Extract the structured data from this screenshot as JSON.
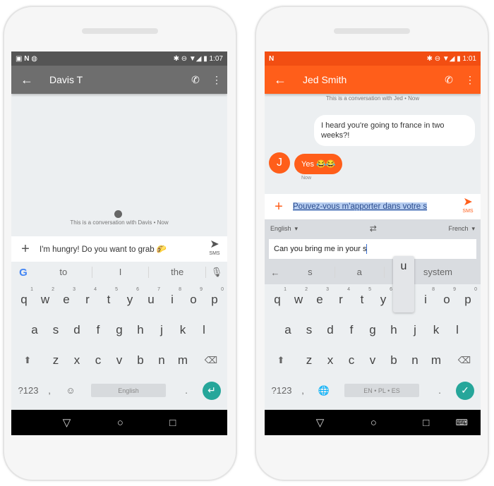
{
  "left_phone": {
    "status": {
      "left_icons": [
        "gallery-icon",
        "n-icon",
        "camera-icon"
      ],
      "time": "1:07",
      "right_icons": [
        "bluetooth-icon",
        "dnd-icon",
        "wifi-icon",
        "signal-icon",
        "battery-icon"
      ]
    },
    "toolbar": {
      "contact": "Davis T",
      "bg": "#6e6e6e",
      "status_bg": "#555555"
    },
    "conversation_note": "This is a conversation with Davis • Now",
    "compose": {
      "text": "I'm hungry! Do you want to grab 🌮",
      "send_label": "SMS"
    },
    "suggestions": [
      "to",
      "I",
      "the"
    ],
    "keyboard": {
      "rows": [
        [
          "q",
          "w",
          "e",
          "r",
          "t",
          "y",
          "u",
          "i",
          "o",
          "p"
        ],
        [
          "a",
          "s",
          "d",
          "f",
          "g",
          "h",
          "j",
          "k",
          "l"
        ],
        [
          "z",
          "x",
          "c",
          "v",
          "b",
          "n",
          "m"
        ]
      ],
      "numbers": [
        "1",
        "2",
        "3",
        "4",
        "5",
        "6",
        "7",
        "8",
        "9",
        "0"
      ],
      "symbols_label": "?123",
      "comma": ",",
      "period": ".",
      "space_label": "English",
      "action": "enter"
    }
  },
  "right_phone": {
    "status": {
      "left_icons": [
        "n-icon"
      ],
      "time": "1:01"
    },
    "toolbar": {
      "contact": "Jed Smith",
      "bg": "#ff5e1a",
      "status_bg": "#f24e12"
    },
    "conversation_note": "This is a conversation with Jed • Now",
    "messages": [
      {
        "from": "me",
        "text": "I heard you're going to france in two weeks?!"
      },
      {
        "from": "Jed",
        "avatar": "J",
        "text": "Yes 😂😂",
        "time": "Now"
      }
    ],
    "compose": {
      "text": "Pouvez-vous m'apporter dans votre s",
      "send_label": "SMS"
    },
    "translate": {
      "from": "English",
      "to": "French",
      "input": "Can you bring me in your s"
    },
    "suggestions": [
      "s",
      "a",
      "system"
    ],
    "key_popup": "u",
    "keyboard": {
      "symbols_label": "?123",
      "comma": ",",
      "period": ".",
      "space_label": "EN • PL • ES",
      "action": "done"
    }
  },
  "colors": {
    "accent_teal": "#26a69a",
    "orange": "#ff5e1a"
  }
}
